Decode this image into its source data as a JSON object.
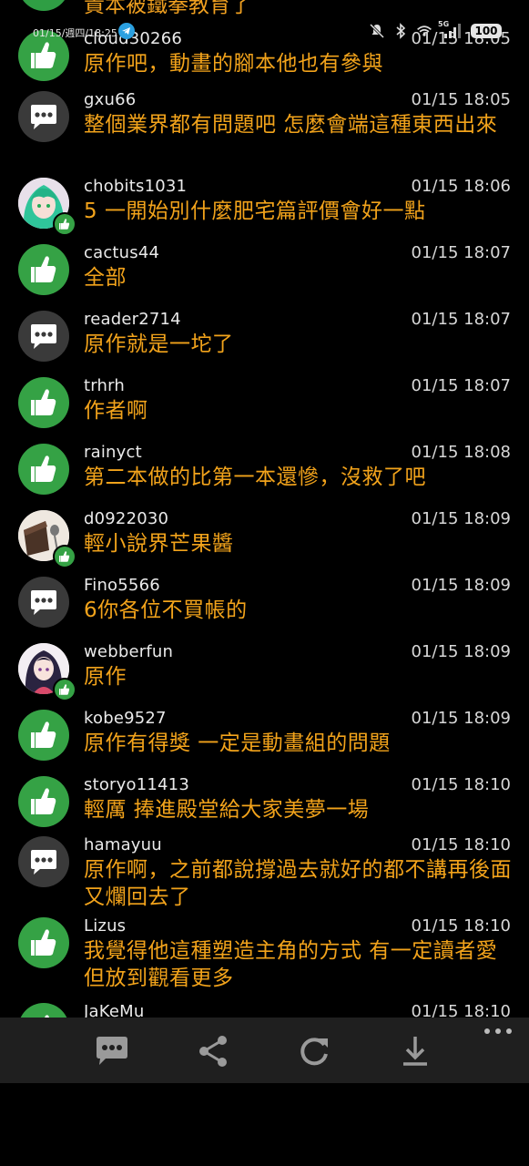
{
  "status_bar": {
    "time": "01/15/週四/18:25",
    "network": "5G",
    "battery": "100"
  },
  "partial_top_text": "貴本被鐵拳教育了",
  "comments": [
    {
      "user": "cloud30266",
      "time": "01/15 18:05",
      "text": "原作吧，動畫的腳本他也有參與",
      "avatar": "thumbs-up"
    },
    {
      "user": "gxu66",
      "time": "01/15 18:05",
      "text": "整個業界都有問題吧 怎麼會端這種東西出來",
      "avatar": "chat"
    },
    {
      "user": "chobits1031",
      "time": "01/15 18:06",
      "text": "5 一開始別什麼肥宅篇評價會好一點",
      "avatar": "photo-green-hair"
    },
    {
      "user": "cactus44",
      "time": "01/15 18:07",
      "text": "全部",
      "avatar": "thumbs-up"
    },
    {
      "user": "reader2714",
      "time": "01/15 18:07",
      "text": "原作就是一坨了",
      "avatar": "chat"
    },
    {
      "user": "trhrh",
      "time": "01/15 18:07",
      "text": "作者啊",
      "avatar": "thumbs-up"
    },
    {
      "user": "rainyct",
      "time": "01/15 18:08",
      "text": "第二本做的比第一本還慘，沒救了吧",
      "avatar": "thumbs-up"
    },
    {
      "user": "d0922030",
      "time": "01/15 18:09",
      "text": "輕小說界芒果醬",
      "avatar": "photo-food"
    },
    {
      "user": "Fino5566",
      "time": "01/15 18:09",
      "text": "6你各位不買帳的",
      "avatar": "chat"
    },
    {
      "user": "webberfun",
      "time": "01/15 18:09",
      "text": "原作",
      "avatar": "photo-anime"
    },
    {
      "user": "kobe9527",
      "time": "01/15 18:09",
      "text": "原作有得獎 一定是動畫組的問題",
      "avatar": "thumbs-up"
    },
    {
      "user": "storyo11413",
      "time": "01/15 18:10",
      "text": "輕厲 捧進殿堂給大家美夢一場",
      "avatar": "thumbs-up"
    },
    {
      "user": "hamayuu",
      "time": "01/15 18:10",
      "text": "原作啊，之前都說撐過去就好的都不講再後面又爛回去了",
      "avatar": "chat"
    },
    {
      "user": "Lizus",
      "time": "01/15 18:10",
      "text": "我覺得他這種塑造主角的方式 有一定讀者愛 但放到觀看更多",
      "avatar": "thumbs-up"
    },
    {
      "user": "JaKeMu",
      "time": "01/15 18:10",
      "text": "",
      "avatar": "thumbs-up"
    }
  ],
  "toolbar": {
    "buttons": [
      "comment-icon",
      "share-icon",
      "refresh-icon",
      "download-icon",
      "more-icon"
    ]
  },
  "colors": {
    "accent_text": "#f2a31b",
    "thumbs_green": "#35a245",
    "chat_gray": "#3a3a3a",
    "toolbar_bg": "#1f1f1f"
  }
}
